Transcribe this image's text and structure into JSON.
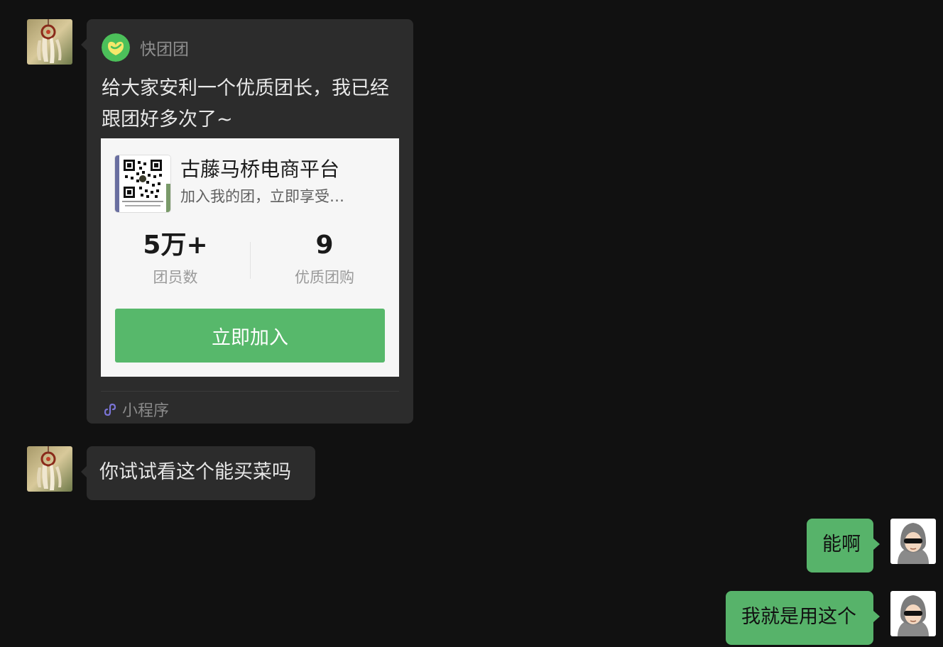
{
  "messages": [
    {
      "type": "mini_program",
      "side": "left",
      "source_name": "快团团",
      "description": "给大家安利一个优质团长，我已经跟团好多次了~",
      "store_name": "古藤马桥电商平台",
      "store_subtitle": "加入我的团，立即享受…",
      "stats": [
        {
          "value": "5万+",
          "label": "团员数"
        },
        {
          "value": "9",
          "label": "优质团购"
        }
      ],
      "join_label": "立即加入",
      "footer_label": "小程序"
    },
    {
      "type": "text",
      "side": "left",
      "text": "你试试看这个能买菜吗"
    },
    {
      "type": "text",
      "side": "right",
      "text": "能啊"
    },
    {
      "type": "text",
      "side": "right",
      "text": "我就是用这个"
    }
  ],
  "colors": {
    "background": "#111111",
    "incoming_bubble": "#2c2c2c",
    "outgoing_bubble": "#57b36a",
    "join_button": "#57b86b"
  },
  "icons": {
    "left_avatar": "dreamcatcher-avatar",
    "right_avatar": "hooded-sunglasses-avatar",
    "mini_program_logo": "kuaituantuan-logo",
    "mini_program_footer": "mini-program-link-icon"
  }
}
